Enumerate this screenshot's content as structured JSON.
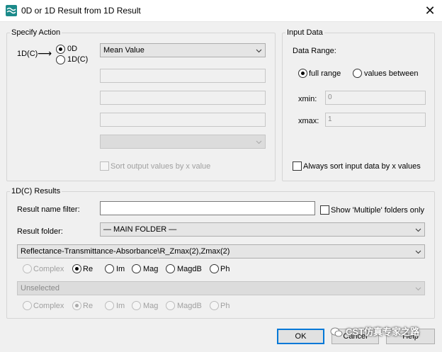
{
  "window": {
    "title": "0D or 1D Result from 1D Result",
    "close_glyph": "✕"
  },
  "specify_action": {
    "legend": "Specify Action",
    "source_label": "1D(C)",
    "arrow": "⟶",
    "output_options": [
      "0D",
      "1D(C)"
    ],
    "selected_output": "0D",
    "operation_value": "Mean Value",
    "text_fields": [
      "",
      "",
      ""
    ],
    "extra_combo_value": "",
    "sort_output_label": "Sort output values by x value",
    "sort_output_checked": false
  },
  "input_data": {
    "legend": "Input Data",
    "range_label": "Data Range:",
    "range_options": [
      "full range",
      "values between"
    ],
    "selected_range": "full range",
    "xmin_label": "xmin:",
    "xmin_value": "0",
    "xmax_label": "xmax:",
    "xmax_value": "1",
    "always_sort_label": "Always sort input data by x values",
    "always_sort_checked": false
  },
  "results": {
    "legend": "1D(C) Results",
    "name_filter_label": "Result name filter:",
    "name_filter_value": "",
    "show_multiple_label": "Show 'Multiple' folders only",
    "show_multiple_checked": false,
    "folder_label": "Result folder:",
    "folder_value": "— MAIN FOLDER —",
    "result_value": "Reflectance-Transmittance-Absorbance\\R_Zmax(2),Zmax(2)",
    "complex_options_1": [
      "Complex",
      "Re",
      "Im",
      "Mag",
      "MagdB",
      "Ph"
    ],
    "selected_complex_1": "Re",
    "second_result_value": "Unselected",
    "complex_options_2": [
      "Complex",
      "Re",
      "Im",
      "Mag",
      "MagdB",
      "Ph"
    ],
    "selected_complex_2": "Re"
  },
  "buttons": {
    "ok": "OK",
    "cancel": "Cancel",
    "help": "Help"
  },
  "watermark": {
    "text": "CST仿真专家之路"
  },
  "colors": {
    "accent": "#0078d7",
    "app_icon": "#1b8a8a"
  }
}
